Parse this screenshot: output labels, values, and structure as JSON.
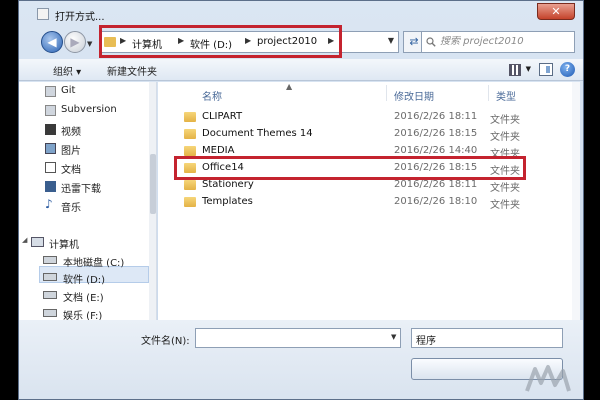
{
  "window": {
    "title": "打开方式..."
  },
  "address": {
    "crumbs": [
      "计算机",
      "软件 (D:)",
      "project2010"
    ],
    "search_placeholder": "搜索 project2010"
  },
  "toolbar": {
    "organize": "组织 ▾",
    "new_folder": "新建文件夹"
  },
  "sidebar": {
    "items": [
      "Git",
      "Subversion",
      "视频",
      "图片",
      "文档",
      "迅雷下载",
      "音乐"
    ],
    "computer": "计算机",
    "drives": [
      "本地磁盘 (C:)",
      "软件 (D:)",
      "文档 (E:)",
      "娱乐 (F:)"
    ]
  },
  "columns": {
    "name": "名称",
    "date": "修改日期",
    "type": "类型"
  },
  "files": [
    {
      "name": "CLIPART",
      "date": "2016/2/26 18:11",
      "type": "文件夹"
    },
    {
      "name": "Document Themes 14",
      "date": "2016/2/26 18:15",
      "type": "文件夹"
    },
    {
      "name": "MEDIA",
      "date": "2016/2/26 14:40",
      "type": "文件夹"
    },
    {
      "name": "Office14",
      "date": "2016/2/26 18:15",
      "type": "文件夹"
    },
    {
      "name": "Stationery",
      "date": "2016/2/26 18:11",
      "type": "文件夹"
    },
    {
      "name": "Templates",
      "date": "2016/2/26 18:10",
      "type": "文件夹"
    }
  ],
  "bottom": {
    "filename_label": "文件名(N):",
    "filter": "程序"
  },
  "colors": {
    "highlight": "#c4232f",
    "folder": "#e4b246",
    "header": "#4a6a98"
  },
  "icons": [
    "folder-icon",
    "back-arrow-icon",
    "forward-arrow-icon",
    "refresh-icon",
    "search-icon",
    "help-icon",
    "view-icon",
    "preview-pane-icon",
    "drive-icon",
    "computer-icon",
    "music-icon"
  ]
}
